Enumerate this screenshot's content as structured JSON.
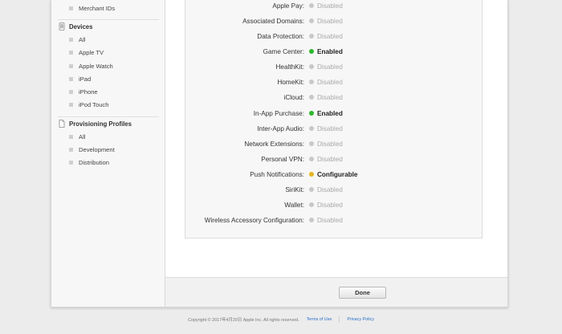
{
  "sidebar": {
    "top_items": [
      {
        "label": "Merchant IDs"
      }
    ],
    "devices": {
      "title": "Devices",
      "items": [
        {
          "label": "All"
        },
        {
          "label": "Apple TV"
        },
        {
          "label": "Apple Watch"
        },
        {
          "label": "iPad"
        },
        {
          "label": "iPhone"
        },
        {
          "label": "iPod Touch"
        }
      ]
    },
    "profiles": {
      "title": "Provisioning Profiles",
      "items": [
        {
          "label": "All"
        },
        {
          "label": "Development"
        },
        {
          "label": "Distribution"
        }
      ]
    }
  },
  "services": [
    {
      "label": "Apple Pay:",
      "status": "Disabled",
      "state": "disabled"
    },
    {
      "label": "Associated Domains:",
      "status": "Disabled",
      "state": "disabled"
    },
    {
      "label": "Data Protection:",
      "status": "Disabled",
      "state": "disabled"
    },
    {
      "label": "Game Center:",
      "status": "Enabled",
      "state": "enabled"
    },
    {
      "label": "HealthKit:",
      "status": "Disabled",
      "state": "disabled"
    },
    {
      "label": "HomeKit:",
      "status": "Disabled",
      "state": "disabled"
    },
    {
      "label": "iCloud:",
      "status": "Disabled",
      "state": "disabled"
    },
    {
      "label": "In-App Purchase:",
      "status": "Enabled",
      "state": "enabled"
    },
    {
      "label": "Inter-App Audio:",
      "status": "Disabled",
      "state": "disabled"
    },
    {
      "label": "Network Extensions:",
      "status": "Disabled",
      "state": "disabled"
    },
    {
      "label": "Personal VPN:",
      "status": "Disabled",
      "state": "disabled"
    },
    {
      "label": "Push Notifications:",
      "status": "Configurable",
      "state": "configurable"
    },
    {
      "label": "SiriKit:",
      "status": "Disabled",
      "state": "disabled"
    },
    {
      "label": "Wallet:",
      "status": "Disabled",
      "state": "disabled"
    },
    {
      "label": "Wireless Accessory Configuration:",
      "status": "Disabled",
      "state": "disabled"
    }
  ],
  "status_colors": {
    "enabled": "#2db82d",
    "disabled": "#c8c8c8",
    "configurable": "#e6b424"
  },
  "footer": {
    "done_label": "Done"
  },
  "page_footer": {
    "copyright": "Copyright © 2017年4月20日 Apple Inc. All rights reserved.",
    "terms": "Terms of Use",
    "privacy": "Privacy Policy"
  }
}
